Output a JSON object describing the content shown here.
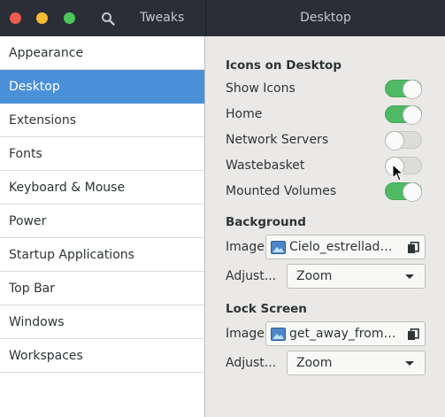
{
  "window": {
    "app_title": "Tweaks",
    "page_title": "Desktop"
  },
  "sidebar": {
    "items": [
      {
        "label": "Appearance",
        "selected": false
      },
      {
        "label": "Desktop",
        "selected": true
      },
      {
        "label": "Extensions",
        "selected": false
      },
      {
        "label": "Fonts",
        "selected": false
      },
      {
        "label": "Keyboard & Mouse",
        "selected": false
      },
      {
        "label": "Power",
        "selected": false
      },
      {
        "label": "Startup Applications",
        "selected": false
      },
      {
        "label": "Top Bar",
        "selected": false
      },
      {
        "label": "Windows",
        "selected": false
      },
      {
        "label": "Workspaces",
        "selected": false
      }
    ]
  },
  "icons_on_desktop": {
    "title": "Icons on Desktop",
    "toggles": [
      {
        "label": "Show Icons",
        "on": true
      },
      {
        "label": "Home",
        "on": true
      },
      {
        "label": "Network Servers",
        "on": false
      },
      {
        "label": "Wastebasket",
        "on": false
      },
      {
        "label": "Mounted Volumes",
        "on": true
      }
    ]
  },
  "background": {
    "title": "Background",
    "image_label": "Image",
    "image_file": "Cielo_estrellado_by_Eduardo_Diez_Viñuela.png",
    "adjust_label": "Adjust...",
    "adjust_value": "Zoom"
  },
  "lock_screen": {
    "title": "Lock Screen",
    "image_label": "Image",
    "image_file": "get_away_from_it_all.jpg",
    "adjust_label": "Adjust...",
    "adjust_value": "Zoom"
  },
  "colors": {
    "titlebar": "#2b2e37",
    "selection": "#4a90d9",
    "switch_on": "#4fba63",
    "switch_off": "#dcdcd8",
    "close": "#ee5c4f",
    "minimize": "#f5be2f",
    "maximize": "#4cc85a"
  },
  "icons": {
    "search": "search-icon",
    "file": "image-file-icon",
    "copy": "copy-icon",
    "dropdown": "chevron-down-icon"
  }
}
